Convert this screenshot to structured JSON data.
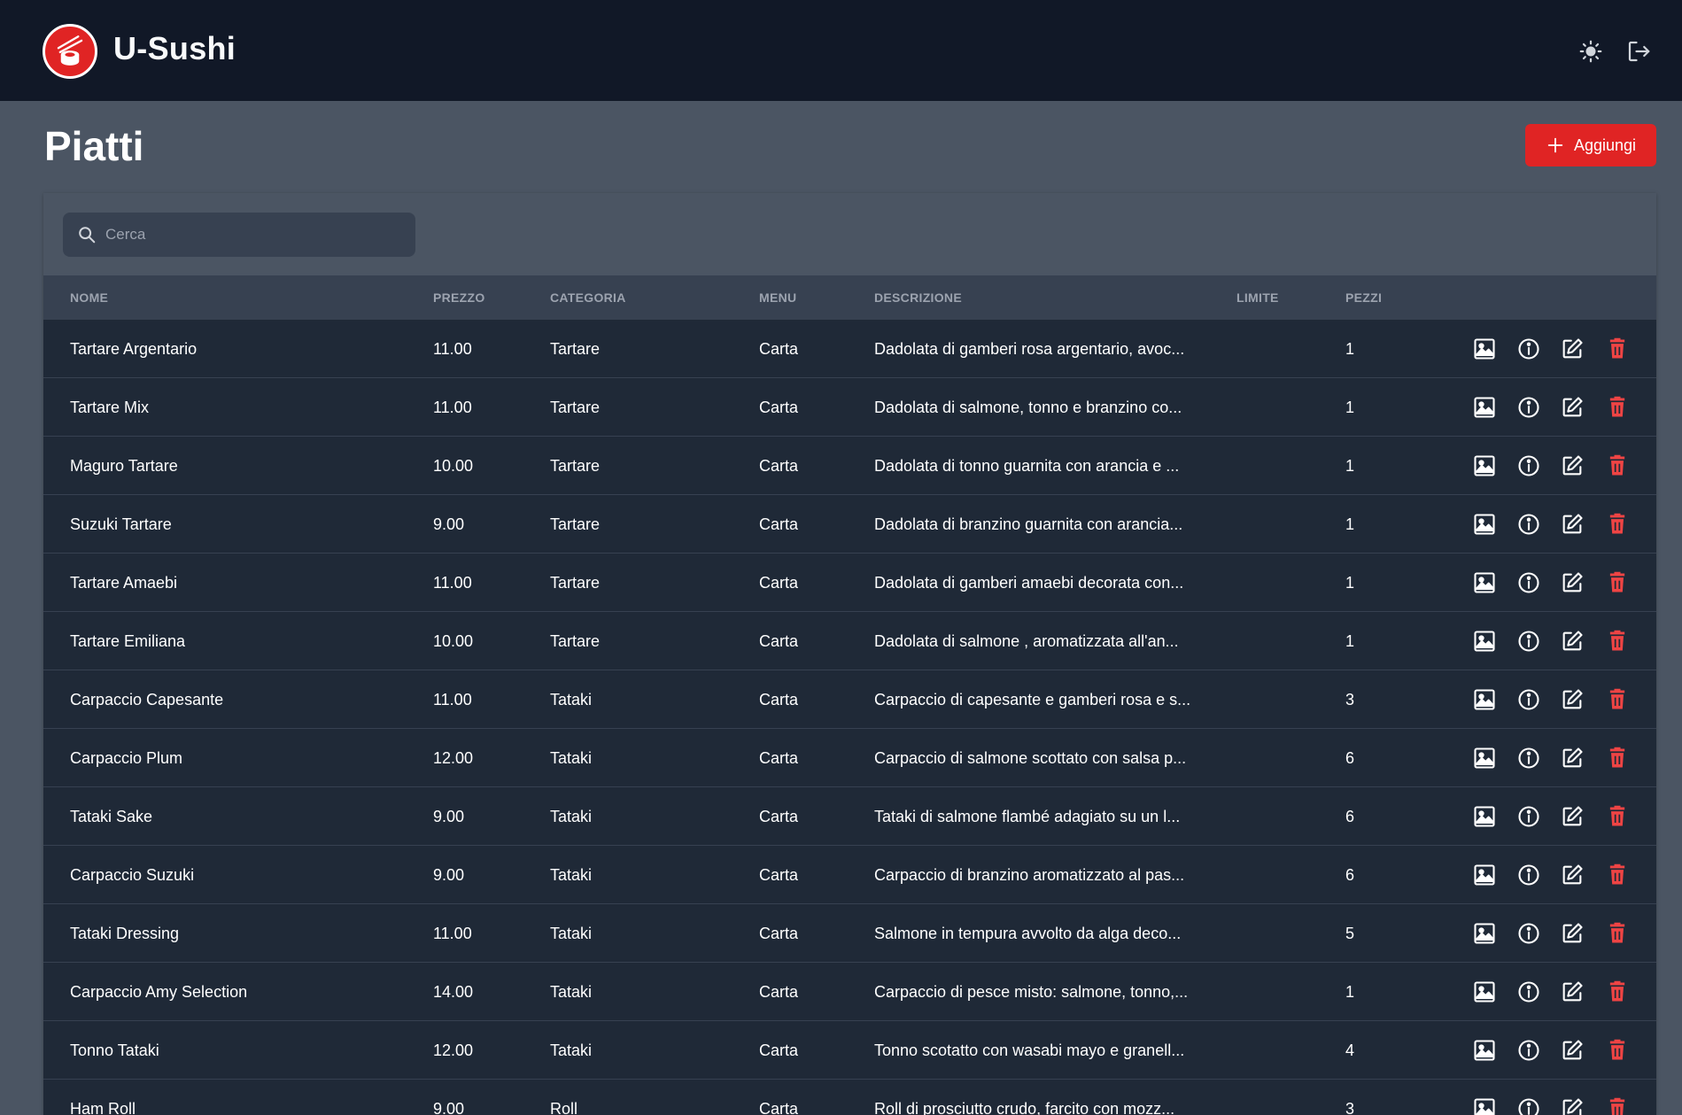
{
  "app": {
    "title": "U-Sushi"
  },
  "colors": {
    "accent": "#e02424",
    "topbar": "#111827",
    "row": "#1f2937",
    "header": "#374151",
    "background": "#4b5563"
  },
  "header_icons": [
    "sun-icon",
    "logout-icon"
  ],
  "page": {
    "title": "Piatti",
    "add_label": "Aggiungi"
  },
  "search": {
    "placeholder": "Cerca",
    "value": ""
  },
  "table": {
    "columns": [
      "NOME",
      "PREZZO",
      "CATEGORIA",
      "MENU",
      "DESCRIZIONE",
      "LIMITE",
      "PEZZI"
    ],
    "row_actions": [
      "image-icon",
      "info-icon",
      "edit-icon",
      "trash-icon"
    ],
    "rows": [
      {
        "nome": "Tartare Argentario",
        "prezzo": "11.00",
        "categoria": "Tartare",
        "menu": "Carta",
        "descrizione": "Dadolata di gamberi rosa argentario, avoc...",
        "limite": "",
        "pezzi": "1"
      },
      {
        "nome": "Tartare Mix",
        "prezzo": "11.00",
        "categoria": "Tartare",
        "menu": "Carta",
        "descrizione": "Dadolata di salmone, tonno e branzino co...",
        "limite": "",
        "pezzi": "1"
      },
      {
        "nome": "Maguro Tartare",
        "prezzo": "10.00",
        "categoria": "Tartare",
        "menu": "Carta",
        "descrizione": "Dadolata di tonno guarnita con arancia e ...",
        "limite": "",
        "pezzi": "1"
      },
      {
        "nome": "Suzuki Tartare",
        "prezzo": "9.00",
        "categoria": "Tartare",
        "menu": "Carta",
        "descrizione": "Dadolata di branzino guarnita con arancia...",
        "limite": "",
        "pezzi": "1"
      },
      {
        "nome": "Tartare Amaebi",
        "prezzo": "11.00",
        "categoria": "Tartare",
        "menu": "Carta",
        "descrizione": "Dadolata di gamberi amaebi decorata con...",
        "limite": "",
        "pezzi": "1"
      },
      {
        "nome": "Tartare Emiliana",
        "prezzo": "10.00",
        "categoria": "Tartare",
        "menu": "Carta",
        "descrizione": "Dadolata di salmone , aromatizzata all'an...",
        "limite": "",
        "pezzi": "1"
      },
      {
        "nome": "Carpaccio Capesante",
        "prezzo": "11.00",
        "categoria": "Tataki",
        "menu": "Carta",
        "descrizione": "Carpaccio di capesante e gamberi rosa e s...",
        "limite": "",
        "pezzi": "3"
      },
      {
        "nome": "Carpaccio Plum",
        "prezzo": "12.00",
        "categoria": "Tataki",
        "menu": "Carta",
        "descrizione": "Carpaccio di salmone scottato con salsa p...",
        "limite": "",
        "pezzi": "6"
      },
      {
        "nome": "Tataki Sake",
        "prezzo": "9.00",
        "categoria": "Tataki",
        "menu": "Carta",
        "descrizione": "Tataki di salmone flambé adagiato su un l...",
        "limite": "",
        "pezzi": "6"
      },
      {
        "nome": "Carpaccio Suzuki",
        "prezzo": "9.00",
        "categoria": "Tataki",
        "menu": "Carta",
        "descrizione": "Carpaccio di branzino aromatizzato al pas...",
        "limite": "",
        "pezzi": "6"
      },
      {
        "nome": "Tataki Dressing",
        "prezzo": "11.00",
        "categoria": "Tataki",
        "menu": "Carta",
        "descrizione": "Salmone in tempura avvolto da alga deco...",
        "limite": "",
        "pezzi": "5"
      },
      {
        "nome": "Carpaccio Amy Selection",
        "prezzo": "14.00",
        "categoria": "Tataki",
        "menu": "Carta",
        "descrizione": "Carpaccio di pesce misto: salmone, tonno,...",
        "limite": "",
        "pezzi": "1"
      },
      {
        "nome": "Tonno Tataki",
        "prezzo": "12.00",
        "categoria": "Tataki",
        "menu": "Carta",
        "descrizione": "Tonno scotatto con wasabi mayo e granell...",
        "limite": "",
        "pezzi": "4"
      },
      {
        "nome": "Ham Roll",
        "prezzo": "9.00",
        "categoria": "Roll",
        "menu": "Carta",
        "descrizione": "Roll di prosciutto crudo, farcito con mozz...",
        "limite": "",
        "pezzi": "3"
      }
    ]
  }
}
